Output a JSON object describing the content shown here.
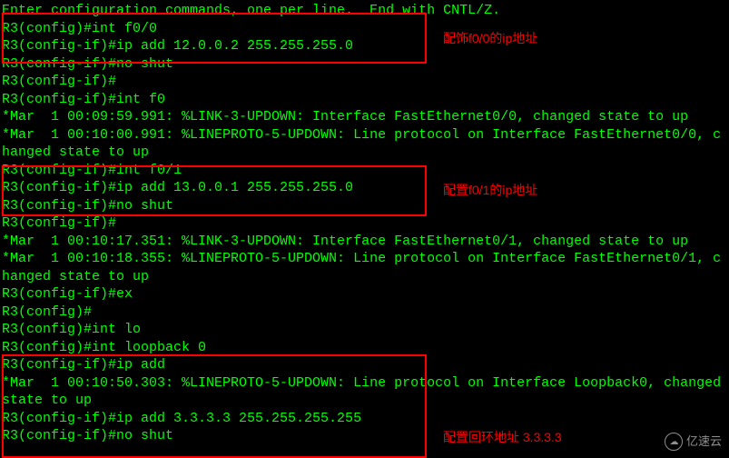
{
  "lines": [
    "Enter configuration commands, one per line.  End with CNTL/Z.",
    "R3(config)#int f0/0",
    "R3(config-if)#ip add 12.0.0.2 255.255.255.0",
    "R3(config-if)#no shut",
    "R3(config-if)#",
    "R3(config-if)#int f0",
    "*Mar  1 00:09:59.991: %LINK-3-UPDOWN: Interface FastEthernet0/0, changed state to up",
    "*Mar  1 00:10:00.991: %LINEPROTO-5-UPDOWN: Line protocol on Interface FastEthernet0/0, changed state to up",
    "R3(config-if)#int f0/1",
    "R3(config-if)#ip add 13.0.0.1 255.255.255.0",
    "R3(config-if)#no shut",
    "R3(config-if)#",
    "*Mar  1 00:10:17.351: %LINK-3-UPDOWN: Interface FastEthernet0/1, changed state to up",
    "*Mar  1 00:10:18.355: %LINEPROTO-5-UPDOWN: Line protocol on Interface FastEthernet0/1, changed state to up",
    "R3(config-if)#ex",
    "R3(config)#",
    "R3(config)#int lo",
    "R3(config)#int loopback 0",
    "R3(config-if)#ip add",
    "*Mar  1 00:10:50.303: %LINEPROTO-5-UPDOWN: Line protocol on Interface Loopback0, changed state to up",
    "R3(config-if)#ip add 3.3.3.3 255.255.255.255",
    "R3(config-if)#no shut"
  ],
  "annotations": {
    "box1": "配饰f0/0的ip地址",
    "box2": "配置f0/1的ip地址",
    "box3": "配置回环地址 3.3.3.3"
  },
  "watermark": "亿速云"
}
